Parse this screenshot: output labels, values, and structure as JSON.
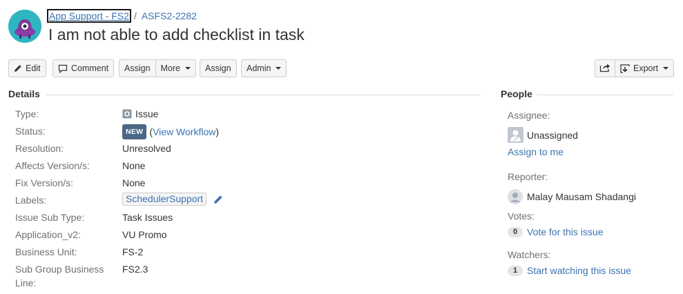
{
  "header": {
    "project_name": "App Support - FS2",
    "separator": "/",
    "issue_key": "ASFS2-2282",
    "summary": "I am not able to add checklist in task"
  },
  "toolbar": {
    "edit_label": "Edit",
    "comment_label": "Comment",
    "assign_label": "Assign",
    "more_label": "More",
    "assign2_label": "Assign",
    "admin_label": "Admin",
    "export_label": "Export"
  },
  "details": {
    "heading": "Details",
    "fields": [
      {
        "label": "Type:",
        "value": "Issue"
      },
      {
        "label": "Status:",
        "lozenge": "NEW",
        "paren_open": "(",
        "link": "View Workflow",
        "paren_close": ")"
      },
      {
        "label": "Resolution:",
        "value": "Unresolved"
      },
      {
        "label": "Affects Version/s:",
        "value": "None"
      },
      {
        "label": "Fix Version/s:",
        "value": "None"
      },
      {
        "label": "Labels:",
        "value": "SchedulerSupport"
      },
      {
        "label": "Issue Sub Type:",
        "value": "Task Issues"
      },
      {
        "label": "Application_v2:",
        "value": "VU Promo"
      },
      {
        "label": "Business Unit:",
        "value": "FS-2"
      },
      {
        "label_line1": "Sub Group Business",
        "label_line2": "Line:",
        "value": "FS2.3"
      }
    ]
  },
  "people": {
    "heading": "People",
    "assignee_label": "Assignee:",
    "assignee_value": "Unassigned",
    "assign_to_me": "Assign to me",
    "reporter_label": "Reporter:",
    "reporter_value": "Malay Mausam Shadangi",
    "votes_label": "Votes:",
    "votes_count": "0",
    "vote_link": "Vote for this issue",
    "watchers_label": "Watchers:",
    "watchers_count": "1",
    "watch_link": "Start watching this issue"
  },
  "colors": {
    "link": "#3b73af",
    "lozenge_bg": "#4a6785",
    "avatar_bg": "#2eb5c0"
  }
}
